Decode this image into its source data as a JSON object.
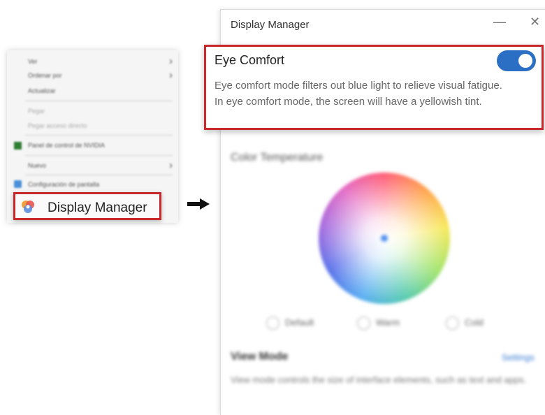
{
  "context_menu": {
    "items": [
      {
        "label": "Ver",
        "submenu": true
      },
      {
        "label": "Ordenar por",
        "submenu": true
      },
      {
        "label": "Actualizar",
        "submenu": false
      },
      {
        "label": "Pegar",
        "submenu": false
      },
      {
        "label": "Pegar acceso directo",
        "submenu": false
      },
      {
        "label": "Panel de control de NVIDIA",
        "submenu": false
      },
      {
        "label": "Nuevo",
        "submenu": true
      },
      {
        "label": "Configuración de pantalla",
        "submenu": false
      }
    ],
    "highlighted_item": "Display Manager"
  },
  "window": {
    "title": "Display Manager",
    "minimize_glyph": "—",
    "close_glyph": "✕",
    "eye_comfort": {
      "title": "Eye Comfort",
      "enabled": true,
      "description_1": "Eye comfort mode filters out blue light to relieve visual fatigue.",
      "description_2": "In eye comfort mode, the screen will have a yellowish tint."
    },
    "color_temperature": {
      "title": "Color Temperature",
      "options": [
        "Default",
        "Warm",
        "Cold"
      ]
    },
    "view_mode": {
      "title": "View Mode",
      "settings_link": "Settings",
      "description": "View mode controls the size of interface elements, such as text and apps."
    }
  },
  "colors": {
    "highlight_border": "#c8282a",
    "toggle_on": "#2b6fc4",
    "link": "#3a7bd5"
  }
}
